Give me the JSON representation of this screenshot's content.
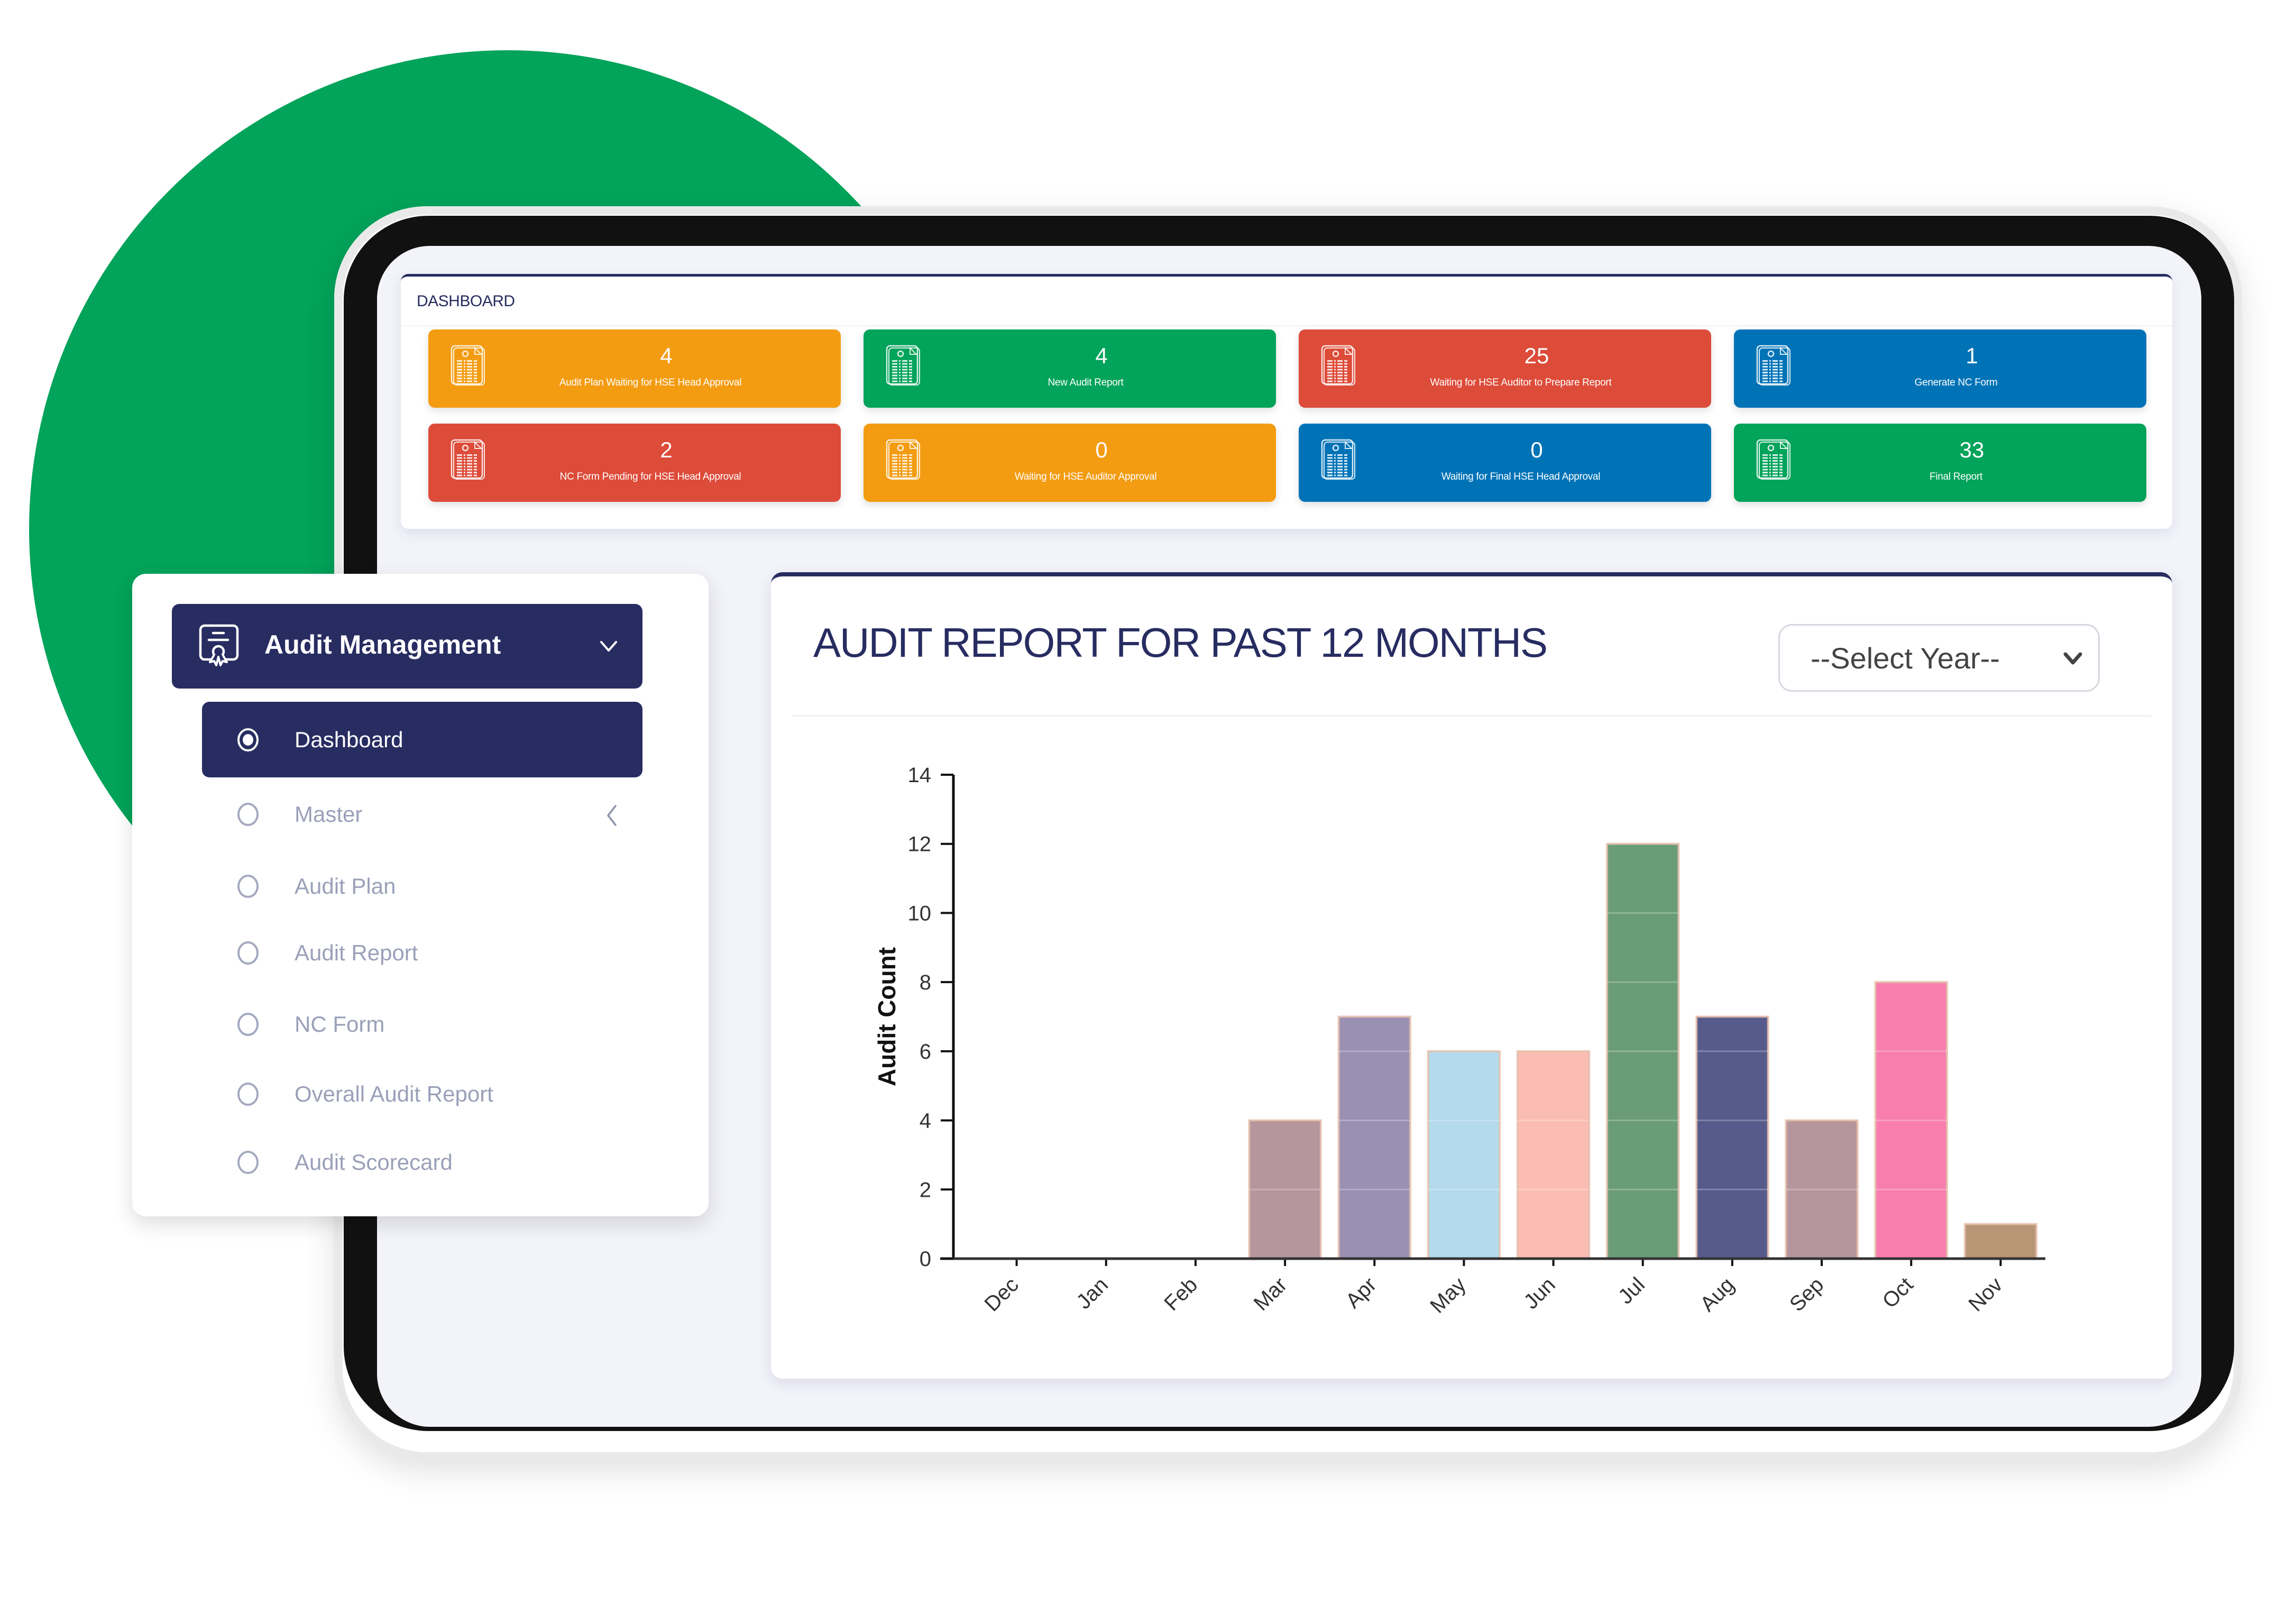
{
  "background": {
    "accent_color": "#02a35a"
  },
  "dashboard": {
    "title": "DASHBOARD",
    "tiles": [
      {
        "value": "4",
        "label": "Audit Plan Waiting for HSE Head Approval",
        "color": "#f39c12",
        "icon": "report-document-icon"
      },
      {
        "value": "4",
        "label": "New Audit Report",
        "color": "#02a35a",
        "icon": "report-document-icon"
      },
      {
        "value": "25",
        "label": "Waiting for HSE Auditor to Prepare Report",
        "color": "#dd4b39",
        "icon": "report-document-icon"
      },
      {
        "value": "1",
        "label": "Generate NC Form",
        "color": "#0073b7",
        "icon": "report-document-icon"
      },
      {
        "value": "2",
        "label": "NC Form Pending for HSE Head Approval",
        "color": "#dd4b39",
        "icon": "report-document-icon"
      },
      {
        "value": "0",
        "label": "Waiting for HSE Auditor Approval",
        "color": "#f39c12",
        "icon": "report-document-icon"
      },
      {
        "value": "0",
        "label": "Waiting for Final HSE Head Approval",
        "color": "#0073b7",
        "icon": "report-document-icon"
      },
      {
        "value": "33",
        "label": "Final Report",
        "color": "#02a35a",
        "icon": "report-document-icon"
      }
    ]
  },
  "chart_panel": {
    "title": "AUDIT REPORT FOR PAST 12 MONTHS",
    "year_select": {
      "selected": "--Select Year--"
    }
  },
  "chart_data": {
    "type": "bar",
    "title": "AUDIT REPORT FOR PAST 12 MONTHS",
    "xlabel": "",
    "ylabel": "Audit Count",
    "categories": [
      "Dec",
      "Jan",
      "Feb",
      "Mar",
      "Apr",
      "May",
      "Jun",
      "Jul",
      "Aug",
      "Sep",
      "Oct",
      "Nov"
    ],
    "values": [
      0,
      0,
      0,
      4,
      7,
      6,
      6,
      12,
      7,
      4,
      8,
      1
    ],
    "colors": [
      "#b4969c",
      "#b4969c",
      "#b4969c",
      "#b4969c",
      "#9a90b3",
      "#b3daed",
      "#fbbdb3",
      "#6b9c78",
      "#575b8c",
      "#b4969c",
      "#f87eaf",
      "#b89574"
    ],
    "ylim": [
      0,
      14
    ],
    "yticks": [
      0,
      2,
      4,
      6,
      8,
      10,
      12,
      14
    ],
    "grid": false,
    "legend": "none"
  },
  "sidebar": {
    "header": {
      "title": "Audit Management",
      "icon": "certificate-icon",
      "expanded": true
    },
    "items": [
      {
        "label": "Dashboard",
        "active": true,
        "has_submenu": false
      },
      {
        "label": "Master",
        "active": false,
        "has_submenu": true
      },
      {
        "label": "Audit Plan",
        "active": false,
        "has_submenu": false
      },
      {
        "label": "Audit Report",
        "active": false,
        "has_submenu": false
      },
      {
        "label": "NC Form",
        "active": false,
        "has_submenu": false
      },
      {
        "label": "Overall Audit Report",
        "active": false,
        "has_submenu": false
      },
      {
        "label": "Audit Scorecard",
        "active": false,
        "has_submenu": false
      }
    ]
  }
}
